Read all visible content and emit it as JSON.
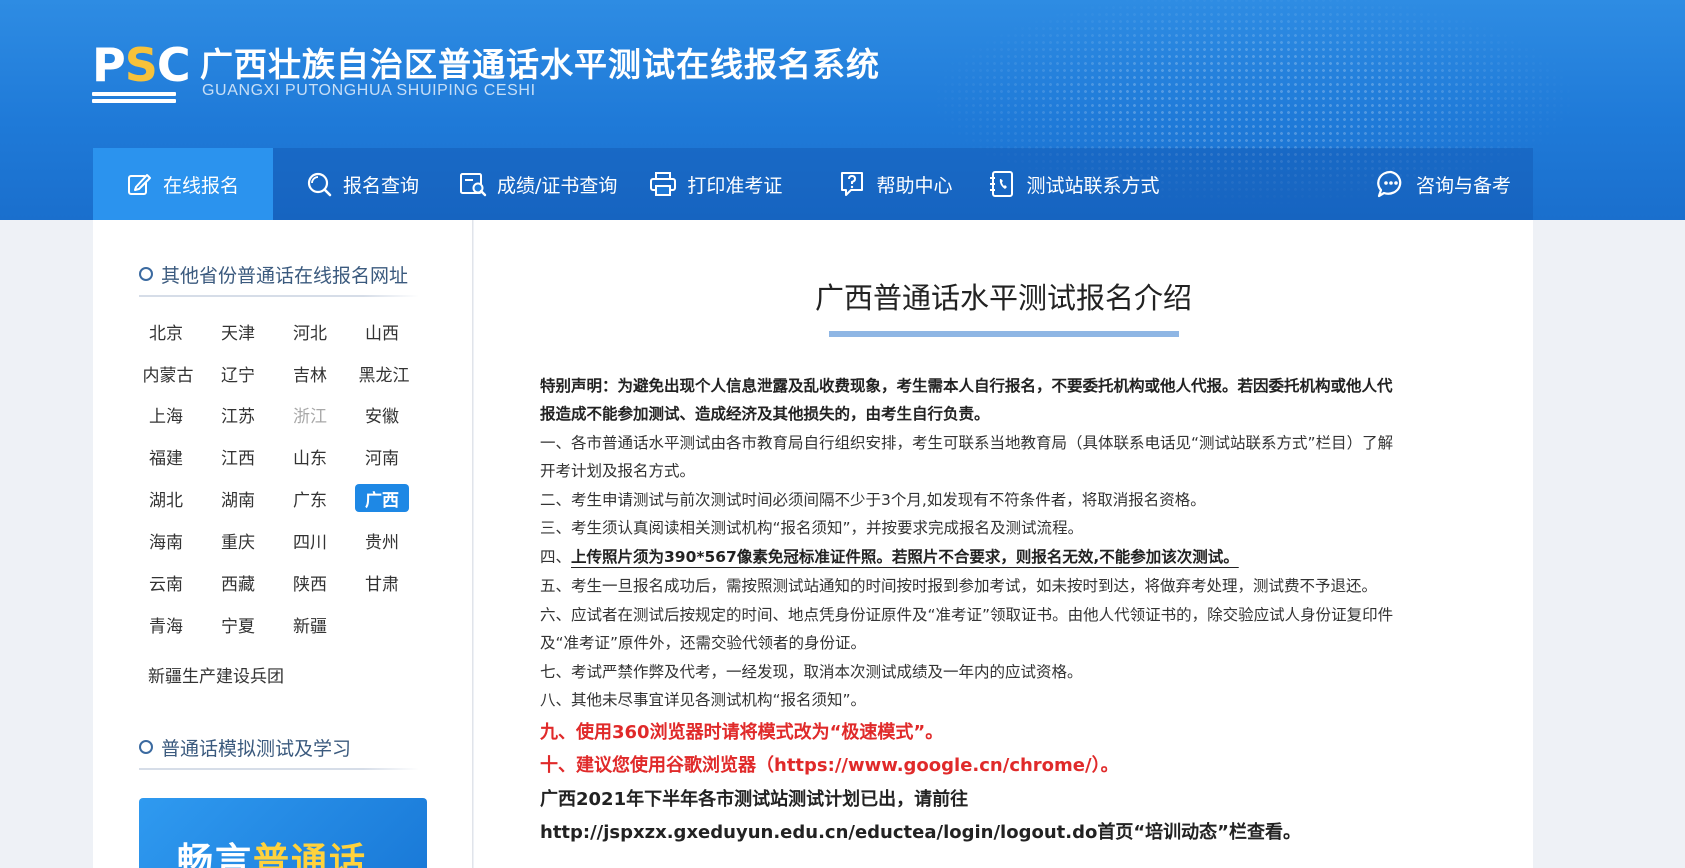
{
  "header": {
    "logo_left": "P",
    "logo_mid": "S",
    "logo_right": "C",
    "title": "广西壮族自治区普通话水平测试在线报名系统",
    "subtitle": "GUANGXI PUTONGHUA SHUIPING CESHI"
  },
  "nav": [
    {
      "label": "在线报名",
      "icon": "edit-icon",
      "active": true
    },
    {
      "label": "报名查询",
      "icon": "search-icon"
    },
    {
      "label": "成绩/证书查询",
      "icon": "certificate-search-icon"
    },
    {
      "label": "打印准考证",
      "icon": "printer-icon"
    },
    {
      "label": "帮助中心",
      "icon": "help-icon"
    },
    {
      "label": "测试站联系方式",
      "icon": "phone-book-icon"
    },
    {
      "label": "咨询与备考",
      "icon": "chat-icon"
    }
  ],
  "sidebar": {
    "section1_title": "其他省份普通话在线报名网址",
    "provinces": [
      "北京",
      "天津",
      "河北",
      "山西",
      "内蒙古",
      "辽宁",
      "吉林",
      "黑龙江",
      "上海",
      "江苏",
      "浙江",
      "安徽",
      "福建",
      "江西",
      "山东",
      "河南",
      "湖北",
      "湖南",
      "广东",
      "广西",
      "海南",
      "重庆",
      "四川",
      "贵州",
      "云南",
      "西藏",
      "陕西",
      "甘肃",
      "青海",
      "宁夏",
      "新疆"
    ],
    "provinces_extra": "新疆生产建设兵团",
    "active_province": "广西",
    "disabled_province": "浙江",
    "section2_title": "普通话模拟测试及学习",
    "banner_white": "畅言",
    "banner_yellow": "普通话"
  },
  "main": {
    "title": "广西普通话水平测试报名介绍",
    "notice_special_1": "特别声明：为避免出现个人信息泄露及乱收费现象，考生需本人自行报名，不要委托机构或他人代报。若因委托机构或他人代",
    "notice_special_2": "报造成不能参加测试、造成经济及其他损失的，由考生自行负责。",
    "item1_a": "一、各市普通话水平测试由各市教育局自行组织安排，考生可联系当地教育局（具体联系电话见“测试站联系方式”栏目）了解",
    "item1_b": "开考计划及报名方式。",
    "item2": "二、考生申请测试与前次测试时间必须间隔不少于3个月,如发现有不符条件者，将取消报名资格。",
    "item3": "三、考生须认真阅读相关测试机构“报名须知”，并按要求完成报名及测试流程。",
    "item4_prefix": "四、",
    "item4_bold": "上传照片须为390*567像素免冠标准证件照。若照片不合要求，则报名无效,不能参加该次测试。",
    "item5": "五、考生一旦报名成功后，需按照测试站通知的时间按时报到参加考试，如未按时到达，将做弃考处理，测试费不予退还。",
    "item6_a": "六、应试者在测试后按规定的时间、地点凭身份证原件及“准考证”领取证书。由他人代领证书的，除交验应试人身份证复印件",
    "item6_b": "及“准考证”原件外，还需交验代领者的身份证。",
    "item7": "七、考试严禁作弊及代考，一经发现，取消本次测试成绩及一年内的应试资格。",
    "item8": "八、其他未尽事宜详见各测试机构“报名须知”。",
    "item9": "九、使用360浏览器时请将模式改为“极速模式”。",
    "item10": "十、建议您使用谷歌浏览器（https://www.google.cn/chrome/）。",
    "plan_line1": "广西2021年下半年各市测试站测试计划已出，请前往",
    "plan_line2": "http://jspxzx.gxeduyun.edu.cn/eductea/login/logout.do首页“培训动态”栏查看。"
  },
  "colors": {
    "header_blue": "#1f7ad8",
    "nav_active": "#2b93ee",
    "province_active": "#1e88e5",
    "notice_red": "#e02a2a",
    "logo_yellow": "#f7c23a"
  }
}
